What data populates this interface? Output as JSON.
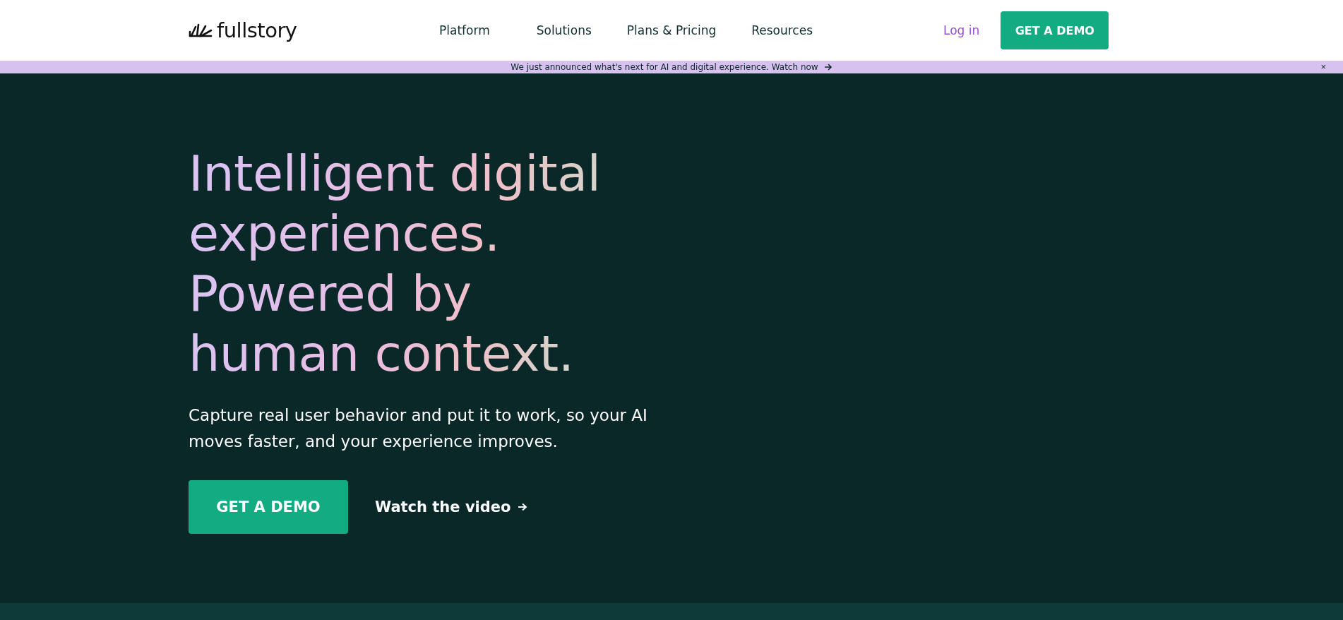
{
  "header": {
    "logo": "fullstory",
    "nav": [
      "Platform",
      "Solutions",
      "Plans & Pricing",
      "Resources"
    ],
    "login": "Log in",
    "cta": "GET A DEMO"
  },
  "announcement": {
    "text": "We just announced what's next for AI and digital experience. Watch now",
    "close": "×"
  },
  "hero": {
    "headline_lines": [
      "Intelligent digital",
      "experiences.",
      "Powered by",
      "human context."
    ],
    "subtitle": "Capture real user behavior and put it to work, so your AI moves faster, and your experience improves.",
    "primary_button": "GET A DEMO",
    "video_link": "Watch the video"
  }
}
